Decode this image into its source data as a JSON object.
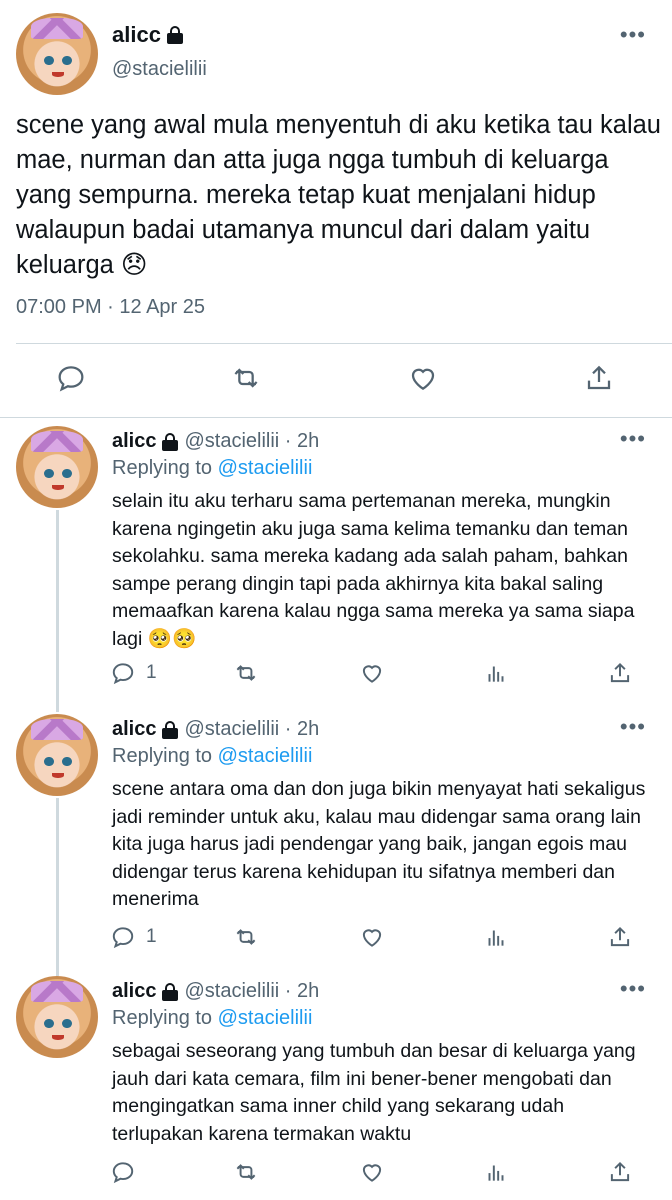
{
  "main_tweet": {
    "display_name": "alicc",
    "handle": "@stacielilii",
    "text": "scene yang awal mula menyentuh di aku ketika tau kalau mae, nurman dan atta juga ngga tumbuh di keluarga yang sempurna. mereka tetap kuat menjalani hidup walaupun badai utamanya muncul dari dalam yaitu keluarga 😞",
    "timestamp": "07:00 PM · 12 Apr 25",
    "more_label": "•••",
    "actions": [
      "reply-icon",
      "retweet-icon",
      "like-icon",
      "share-icon"
    ]
  },
  "replies": [
    {
      "display_name": "alicc",
      "meta": "@stacielilii · 2h",
      "replying_prefix": "Replying to",
      "replying_to": "@stacielilii",
      "text": "selain itu aku terharu sama pertemanan mereka, mungkin karena ngingetin aku juga sama kelima temanku dan teman sekolahku. sama mereka kadang ada salah paham, bahkan sampe perang dingin tapi pada akhirnya kita bakal saling memaafkan karena kalau ngga sama mereka ya sama siapa lagi 🥺🥺",
      "reply_count": "1",
      "more_label": "•••"
    },
    {
      "display_name": "alicc",
      "meta": "@stacielilii · 2h",
      "replying_prefix": "Replying to",
      "replying_to": "@stacielilii",
      "text": "scene antara oma dan don juga bikin menyayat hati sekaligus jadi reminder untuk aku, kalau mau didengar sama orang lain kita juga harus jadi pendengar yang baik, jangan egois mau didengar terus karena kehidupan itu sifatnya memberi dan menerima",
      "reply_count": "1",
      "more_label": "•••"
    },
    {
      "display_name": "alicc",
      "meta": "@stacielilii · 2h",
      "replying_prefix": "Replying to",
      "replying_to": "@stacielilii",
      "text": "sebagai seseorang yang tumbuh dan besar di keluarga yang jauh dari kata cemara, film ini bener-bener mengobati dan mengingatkan sama inner child yang sekarang udah terlupakan karena termakan waktu",
      "reply_count": "",
      "more_label": "•••"
    }
  ],
  "colors": {
    "text_primary": "#0f1419",
    "text_secondary": "#536471",
    "link": "#1d9bf0",
    "divider": "#cfd9de"
  }
}
